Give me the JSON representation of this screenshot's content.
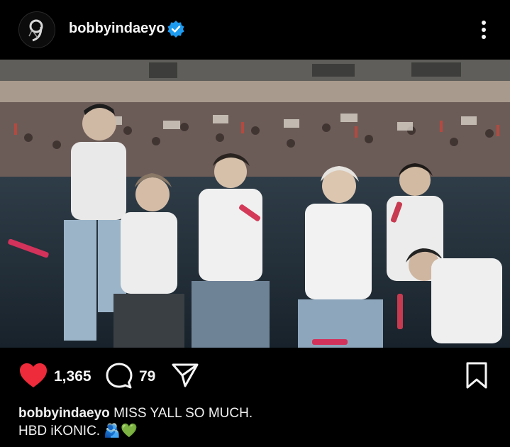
{
  "post": {
    "username": "bobbyindaeyo",
    "verified": true,
    "likes": "1,365",
    "comments": "79",
    "caption_line1": "MISS YALL SO MUCH.",
    "caption_line2": "HBD iKONIC.",
    "caption_emoji": "🫂💚"
  },
  "icons": {
    "avatar": "avatar-logo",
    "verified": "verified-badge-icon",
    "more": "more-vertical-icon",
    "like": "heart-filled-icon",
    "comment": "comment-bubble-icon",
    "share": "paper-plane-icon",
    "save": "bookmark-icon"
  },
  "colors": {
    "background": "#000000",
    "like_red": "#ed2b3a",
    "verified_blue": "#1d9bf0",
    "text": "#f5f5f5"
  }
}
